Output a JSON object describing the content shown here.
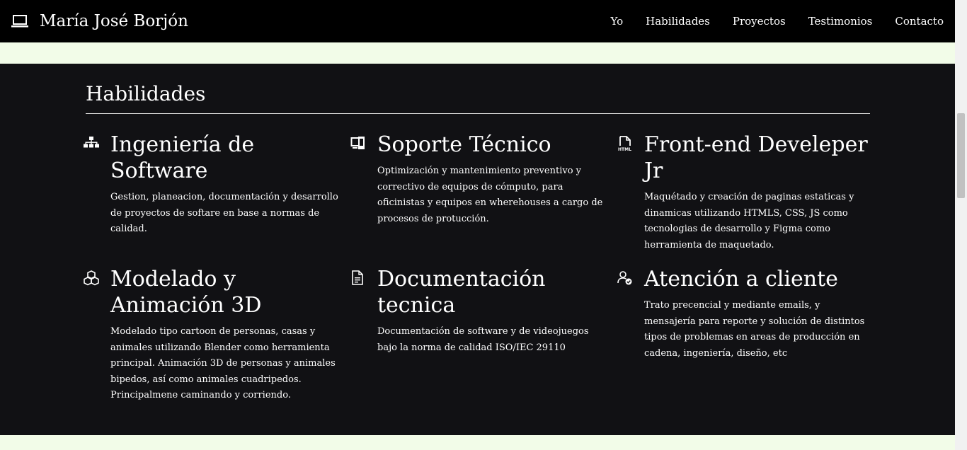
{
  "brand": {
    "name": "María José Borjón",
    "icon": "laptop-icon"
  },
  "nav": [
    {
      "label": "Yo"
    },
    {
      "label": "Habilidades"
    },
    {
      "label": "Proyectos"
    },
    {
      "label": "Testimonios"
    },
    {
      "label": "Contacto"
    }
  ],
  "skills": {
    "title": "Habilidades",
    "items": [
      {
        "icon": "sitemap-icon",
        "title": "Ingeniería de Software",
        "description": "Gestion, planeacion, documentación y desarrollo de proyectos de softare en base a normas de calidad."
      },
      {
        "icon": "devices-icon",
        "title": "Soporte Técnico",
        "description": "Optimización y mantenimiento preventivo y correctivo de equipos de cómputo, para oficinistas y equipos en wherehouses a cargo de procesos de protucción."
      },
      {
        "icon": "html-file-icon",
        "title": "Front-end Develeper Jr",
        "description": "Maquétado y creación de paginas estaticas y dinamicas utilizando HTMLS, CSS, JS como tecnologias de desarrollo y Figma como herramienta de maquetado."
      },
      {
        "icon": "boxes-3d-icon",
        "title": "Modelado y Animación 3D",
        "description": "Modelado tipo cartoon de personas, casas y animales utilizando Blender como herramienta principal. Animación 3D de personas y animales bipedos, así como animales cuadripedos. Principalmene caminando y corriendo."
      },
      {
        "icon": "document-icon",
        "title": "Documentación tecnica",
        "description": "Documentación de software y de videojuegos bajo la norma de calidad ISO/IEC 29110"
      },
      {
        "icon": "user-check-icon",
        "title": "Atención a cliente",
        "description": "Trato precencial y mediante emails, y mensajería para reporte y solución de distintos tipos de problemas en areas de producción en cadena, ingeniería, diseño, etc"
      }
    ]
  },
  "colors": {
    "navbar": "#000000",
    "page_background": "#f2fce8",
    "section_background": "#111114",
    "text": "#ffffff"
  }
}
